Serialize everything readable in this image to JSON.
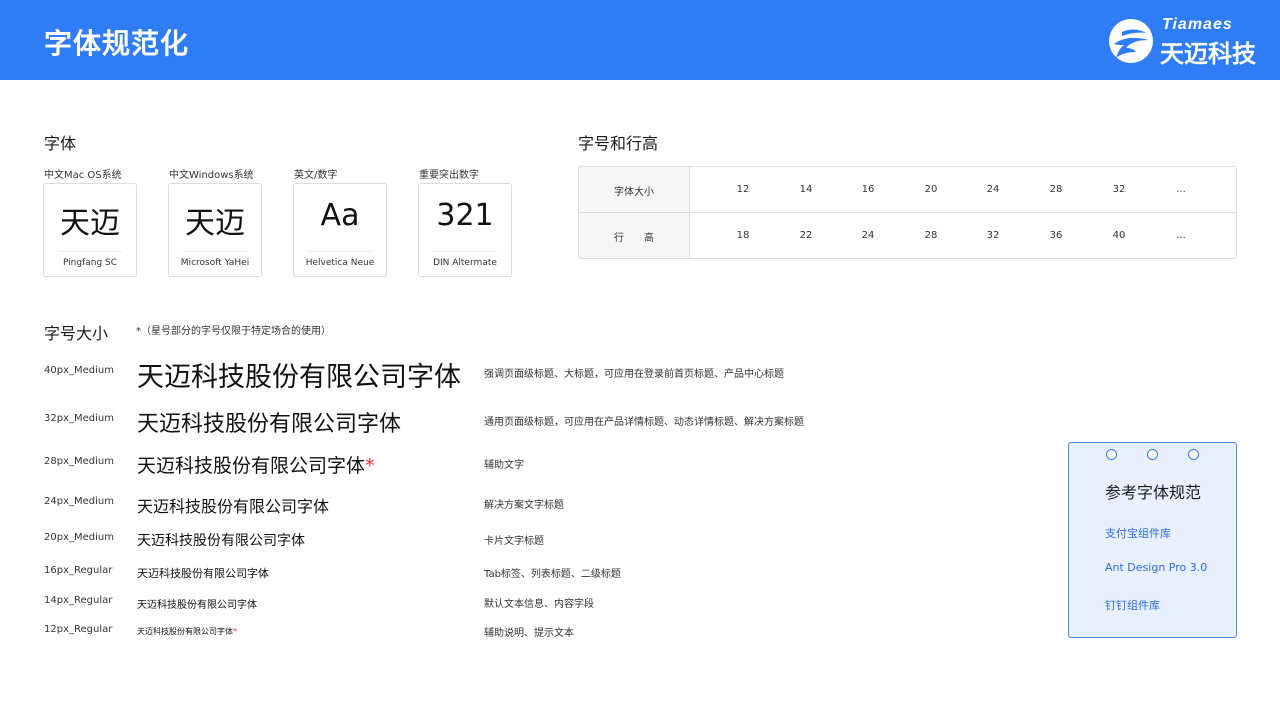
{
  "header": {
    "title": "字体规范化",
    "logo_en": "Tiamaes",
    "logo_cn": "天迈科技",
    "bg_color": "#2e7cf6"
  },
  "fonts_section": {
    "title": "字体",
    "cards": [
      {
        "label": "中文Mac OS系统",
        "sample": "天迈",
        "font": "Pingfang SC"
      },
      {
        "label": "中文Windows系统",
        "sample": "天迈",
        "font": "Microsoft YaHei"
      },
      {
        "label": "英文/数字",
        "sample": "Aa",
        "font": "Helvetica Neue"
      },
      {
        "label": "重要突出数字",
        "sample": "321",
        "font": "DIN Altermate"
      }
    ]
  },
  "size_line_section": {
    "title": "字号和行高",
    "rows": [
      {
        "head": "字体大小",
        "values": [
          "12",
          "14",
          "16",
          "20",
          "24",
          "28",
          "32",
          "..."
        ]
      },
      {
        "head": "行　　高",
        "values": [
          "18",
          "22",
          "24",
          "28",
          "32",
          "36",
          "40",
          "..."
        ]
      }
    ]
  },
  "font_size_section": {
    "title": "字号大小",
    "note": "*（星号部分的字号仅限于特定场合的使用）",
    "sample_text": "天迈科技股份有限公司字体",
    "star": "*",
    "rows": [
      {
        "label": "40px_Medium",
        "size": 40,
        "star": false,
        "desc": "强调页面级标题、大标题，可应用在登录前首页标题、产品中心标题"
      },
      {
        "label": "32px_Medium",
        "size": 32,
        "star": false,
        "desc": "通用页面级标题，可应用在产品详情标题、动态详情标题、解决方案标题"
      },
      {
        "label": "28px_Medium",
        "size": 28,
        "star": true,
        "desc": "辅助文字"
      },
      {
        "label": "24px_Medium",
        "size": 24,
        "star": false,
        "desc": "解决方案文字标题"
      },
      {
        "label": "20px_Medium",
        "size": 20,
        "star": false,
        "desc": "卡片文字标题"
      },
      {
        "label": "16px_Regular",
        "size": 16,
        "star": false,
        "desc": "Tab标签、列表标题、二级标题"
      },
      {
        "label": "14px_Regular",
        "size": 14,
        "star": false,
        "desc": "默认文本信息、内容字段"
      },
      {
        "label": "12px_Regular",
        "size": 12,
        "star": true,
        "desc": "辅助说明、提示文本"
      }
    ]
  },
  "reference_card": {
    "title": "参考字体规范",
    "links": [
      "支付宝组件库",
      "Ant Design Pro 3.0",
      "钉钉组件库"
    ]
  }
}
